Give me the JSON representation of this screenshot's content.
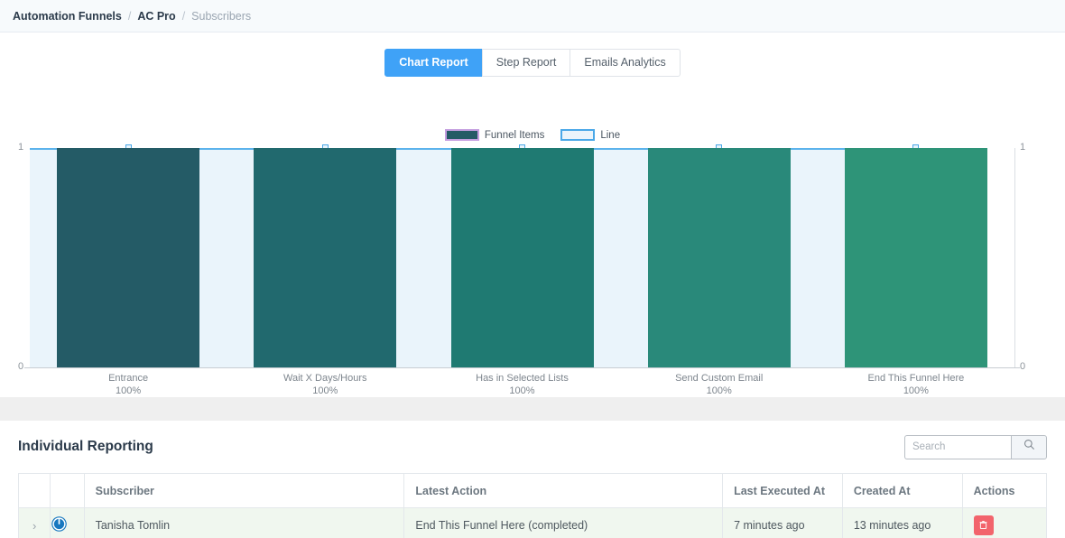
{
  "breadcrumb": {
    "root": "Automation Funnels",
    "parent": "AC Pro",
    "current": "Subscribers",
    "separator": "/"
  },
  "tabs": [
    {
      "label": "Chart Report",
      "active": true
    },
    {
      "label": "Step Report",
      "active": false
    },
    {
      "label": "Emails Analytics",
      "active": false
    }
  ],
  "legend": [
    {
      "label": "Funnel Items",
      "color": "#245b66",
      "style": "bar"
    },
    {
      "label": "Line",
      "color": "#4aa8e8",
      "style": "line"
    }
  ],
  "axes": {
    "left_ticks": [
      "1",
      "0"
    ],
    "right_ticks": [
      "1",
      "0"
    ]
  },
  "chart_data": {
    "type": "bar",
    "title": "",
    "xlabel": "",
    "ylabel": "",
    "ylim": [
      0,
      1
    ],
    "grid": false,
    "legend_position": "top-center",
    "categories": [
      "Entrance",
      "Wait X Days/Hours",
      "Has in Selected Lists",
      "Send Custom Email",
      "End This Funnel Here"
    ],
    "category_percents": [
      "100%",
      "100%",
      "100%",
      "100%",
      "100%"
    ],
    "series": [
      {
        "name": "Funnel Items",
        "type": "bar",
        "values": [
          1,
          1,
          1,
          1,
          1
        ],
        "colors": [
          "#245b66",
          "#21696e",
          "#1f7a72",
          "#29897a",
          "#2e9478"
        ]
      },
      {
        "name": "Line",
        "type": "area",
        "values": [
          1,
          1,
          1,
          1,
          1
        ],
        "line_color": "#5cb3ec",
        "fill_color": "#eaf4fb"
      }
    ]
  },
  "report": {
    "title": "Individual Reporting",
    "search": {
      "value": "",
      "placeholder": "Search",
      "button_icon": "search-icon"
    },
    "columns": [
      "",
      "",
      "Subscriber",
      "Latest Action",
      "Last Executed At",
      "Created At",
      "Actions"
    ],
    "rows": [
      {
        "expander": "›",
        "status_icon": "power-icon",
        "subscriber": "Tanisha Tomlin",
        "latest_action": "End This Funnel Here (completed)",
        "last_executed_at": "7 minutes ago",
        "created_at": "13 minutes ago",
        "delete_icon": "trash-icon"
      }
    ]
  },
  "colors": {
    "accent_blue": "#3fa2f7",
    "bar_dark": "#245b66",
    "bar_light": "#2e9478",
    "line_blue": "#4aa8e8",
    "danger": "#f2646c",
    "row_green": "#f0f7ef"
  }
}
